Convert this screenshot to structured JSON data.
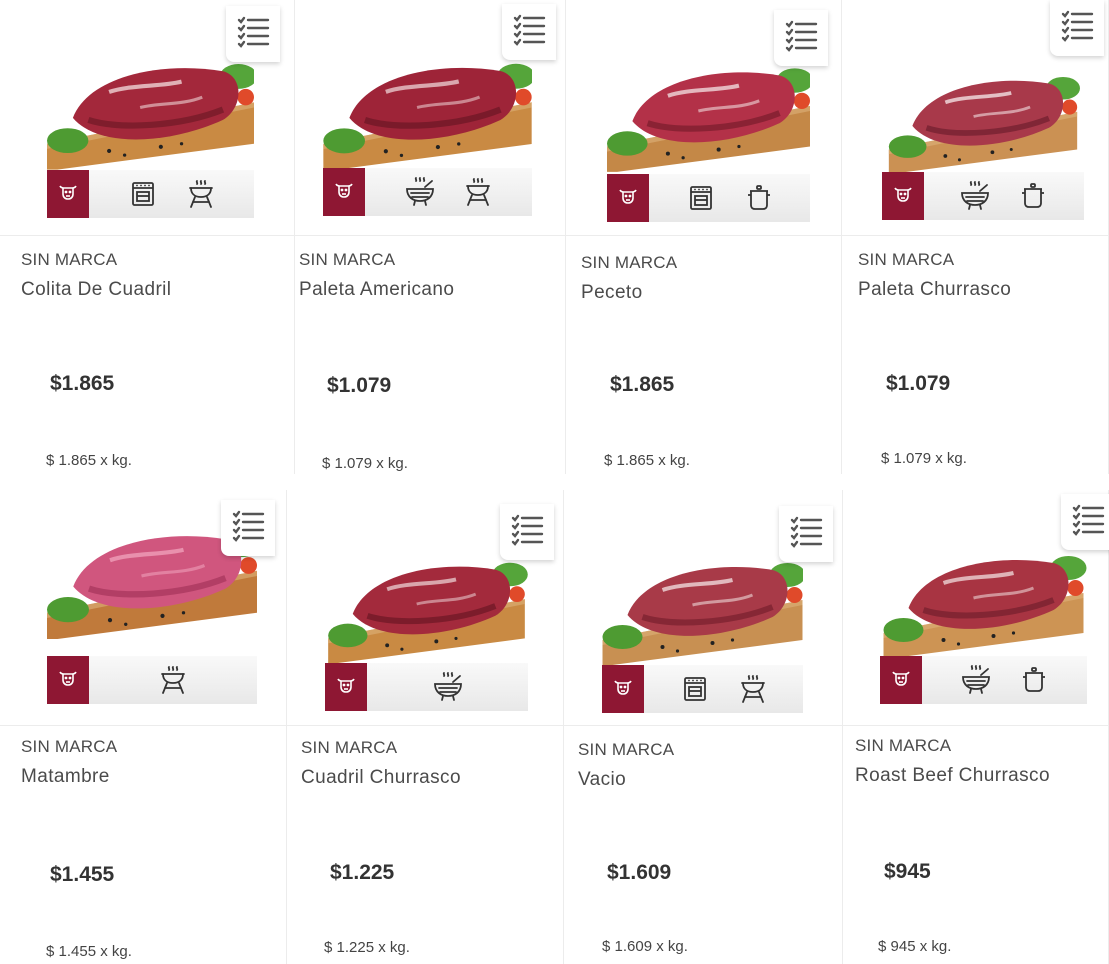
{
  "colors": {
    "accent": "#8e1733",
    "text": "#4b4b4b",
    "price": "#333333",
    "divider": "#ececec"
  },
  "products": [
    {
      "brand": "SIN MARCA",
      "name": "Colita De Cuadril",
      "price": "$1.865",
      "unit_price": "$ 1.865 x kg.",
      "cook_icons": [
        "oven-icon",
        "grill-icon"
      ]
    },
    {
      "brand": "SIN MARCA",
      "name": "Paleta Americano",
      "price": "$1.079",
      "unit_price": "$ 1.079 x kg.",
      "cook_icons": [
        "stew-icon",
        "grill-icon"
      ]
    },
    {
      "brand": "SIN MARCA",
      "name": "Peceto",
      "price": "$1.865",
      "unit_price": "$ 1.865 x kg.",
      "cook_icons": [
        "oven-icon",
        "pot-icon"
      ]
    },
    {
      "brand": "SIN MARCA",
      "name": "Paleta Churrasco",
      "price": "$1.079",
      "unit_price": "$ 1.079 x kg.",
      "cook_icons": [
        "stew-icon",
        "pot-icon"
      ]
    },
    {
      "brand": "SIN MARCA",
      "name": "Matambre",
      "price": "$1.455",
      "unit_price": "$ 1.455 x kg.",
      "cook_icons": [
        "grill-icon"
      ]
    },
    {
      "brand": "SIN MARCA",
      "name": "Cuadril Churrasco",
      "price": "$1.225",
      "unit_price": "$ 1.225 x kg.",
      "cook_icons": [
        "stew-icon"
      ]
    },
    {
      "brand": "SIN MARCA",
      "name": "Vacio",
      "price": "$1.609",
      "unit_price": "$ 1.609 x kg.",
      "cook_icons": [
        "oven-icon",
        "grill-icon"
      ]
    },
    {
      "brand": "SIN MARCA",
      "name": "Roast Beef Churrasco",
      "price": "$945",
      "unit_price": "$ 945 x kg.",
      "cook_icons": [
        "stew-icon",
        "pot-icon"
      ]
    }
  ]
}
